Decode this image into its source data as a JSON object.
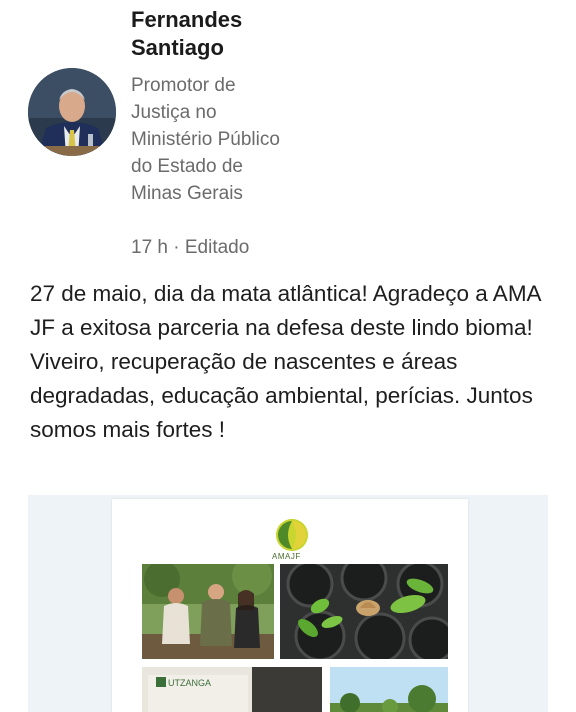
{
  "post": {
    "author_name": "Fernandes Santiago",
    "author_headline": "Promotor de Justiça no Ministério Público do Estado de Minas Gerais",
    "timestamp": "17 h",
    "edited_label": "Editado",
    "separator": " · ",
    "body": "27 de maio, dia da mata atlântica! Agradeço a AMA JF a exitosa parceria na defesa deste lindo bioma! Viveiro, recuperação de nascentes e áreas degradadas, educação ambiental, perícias. Juntos somos mais fortes !"
  },
  "attachment": {
    "logo_text": "AMAJF",
    "bag_label": "UTZANGA"
  },
  "colors": {
    "text_primary": "#1b1b1b",
    "text_secondary": "#6b6b6b",
    "attachment_bg": "#eef3f8",
    "logo_green": "#c9d62f"
  }
}
